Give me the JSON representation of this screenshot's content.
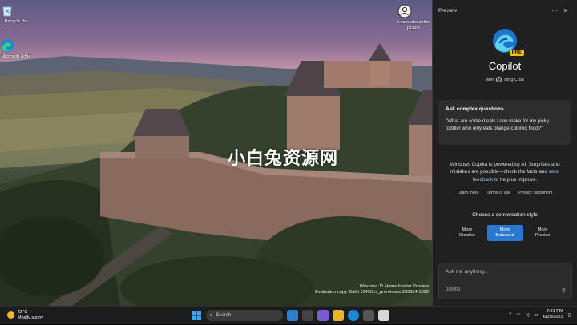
{
  "desktop": {
    "icons": [
      {
        "label": "Recycle Bin",
        "icon": "recycle-bin-icon"
      },
      {
        "label": "Microsoft Edge",
        "icon": "edge-icon"
      },
      {
        "label": "Learn about this picture",
        "icon": "learn-picture-icon"
      }
    ],
    "watermark_line1": "Windows 11 Home Insider Preview",
    "watermark_line2": "Evaluation copy. Build 23493.ni_prerelease.230624-1828",
    "overlay_brand": "小白兔资源网"
  },
  "pane": {
    "header_title": "Preview",
    "more_icon": "more-icon",
    "close_icon": "close-icon",
    "app_title": "Copilot",
    "badge": "PRE",
    "with_label": "with",
    "bing_chat": "Bing Chat",
    "card_title": "Ask complex questions",
    "card_body": "\"What are some meals I can make for my picky toddler who only eats orange-colored food?\"",
    "disclaimer_part1": "Windows Copilot is powered by AI. Surprises and mistakes are possible—check the facts and",
    "disclaimer_link": "send feedback",
    "disclaimer_part2": "to help us improve.",
    "links": [
      "Learn more",
      "Terms of use",
      "Privacy Statement"
    ],
    "style_title": "Choose a conversation style",
    "styles": [
      {
        "line1": "More",
        "line2": "Creative",
        "active": false
      },
      {
        "line1": "More",
        "line2": "Balanced",
        "active": true
      },
      {
        "line1": "More",
        "line2": "Precise",
        "active": false
      }
    ],
    "input_placeholder": "Ask me anything...",
    "char_count": "0/2000",
    "accent_color": "#2878d0"
  },
  "taskbar": {
    "temperature": "22°C",
    "weather": "Mostly sunny",
    "search_label": "Search",
    "time": "7:21 PM",
    "date": "6/29/2023",
    "tray_expand": "^"
  }
}
